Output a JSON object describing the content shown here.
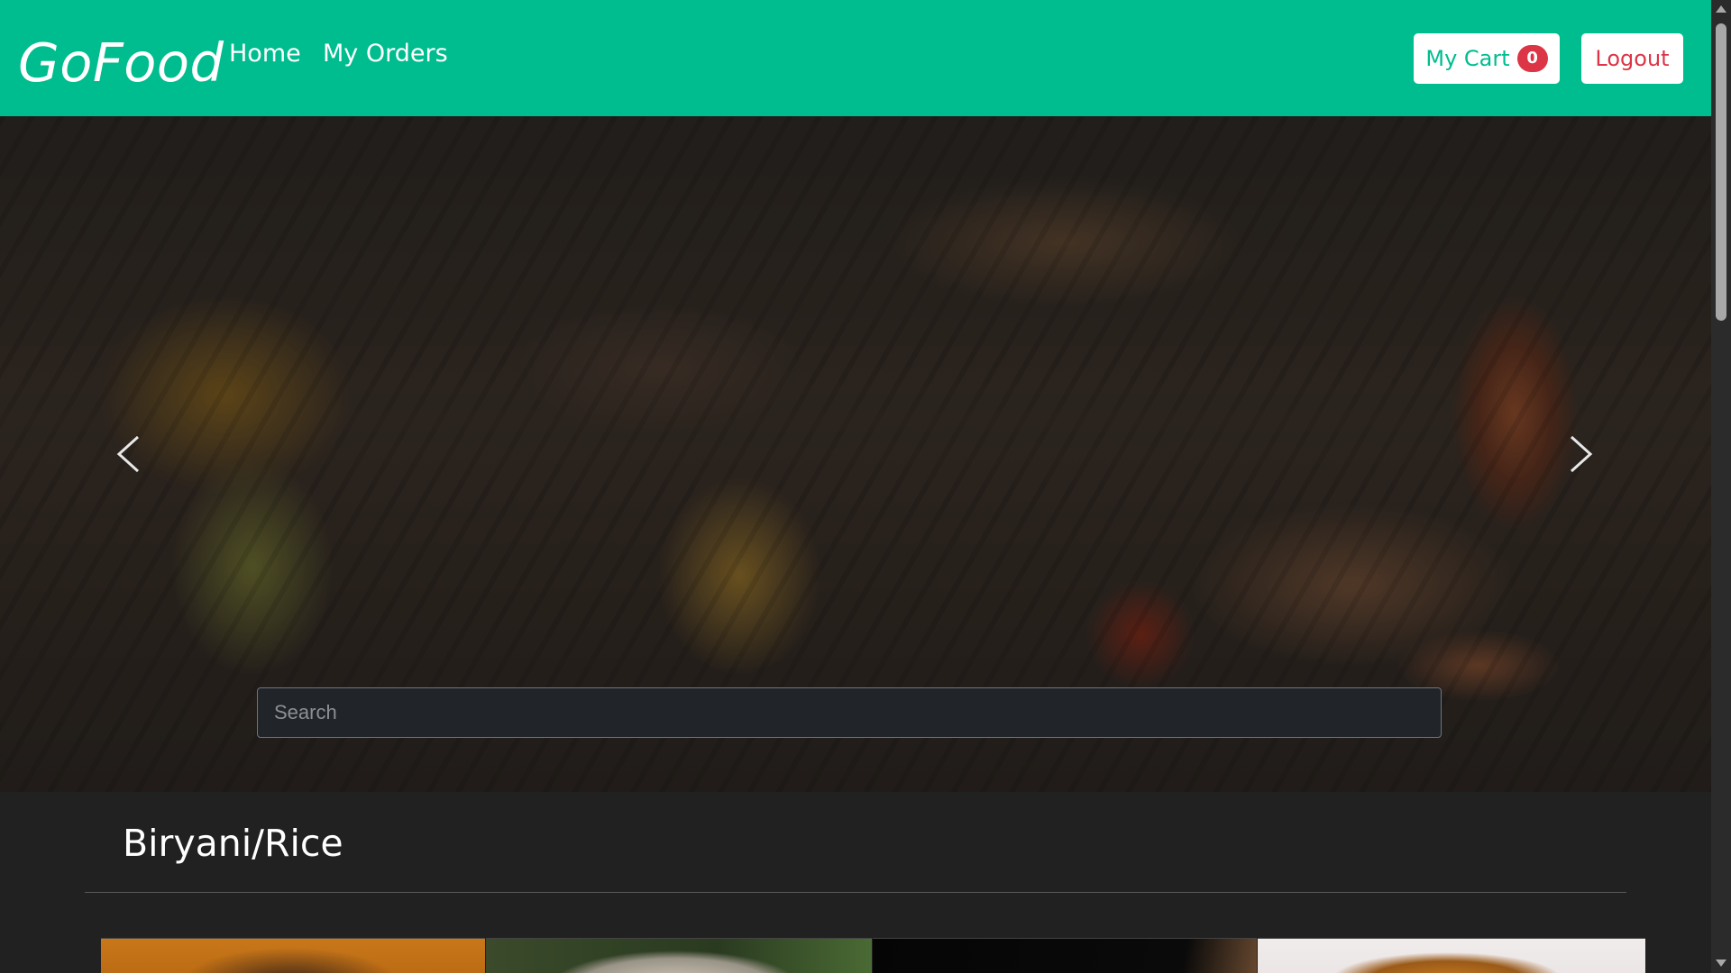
{
  "navbar": {
    "brand": "GoFood",
    "links": [
      "Home",
      "My Orders"
    ],
    "cart_label": "My Cart",
    "cart_count": "0",
    "logout_label": "Logout"
  },
  "colors": {
    "primary": "#00bd8f",
    "danger": "#dc3545",
    "background": "#212121"
  },
  "carousel": {
    "prev_icon": "chevron-left-icon",
    "next_icon": "chevron-right-icon"
  },
  "search": {
    "placeholder": "Search",
    "value": ""
  },
  "main": {
    "category_title": "Biryani/Rice"
  }
}
